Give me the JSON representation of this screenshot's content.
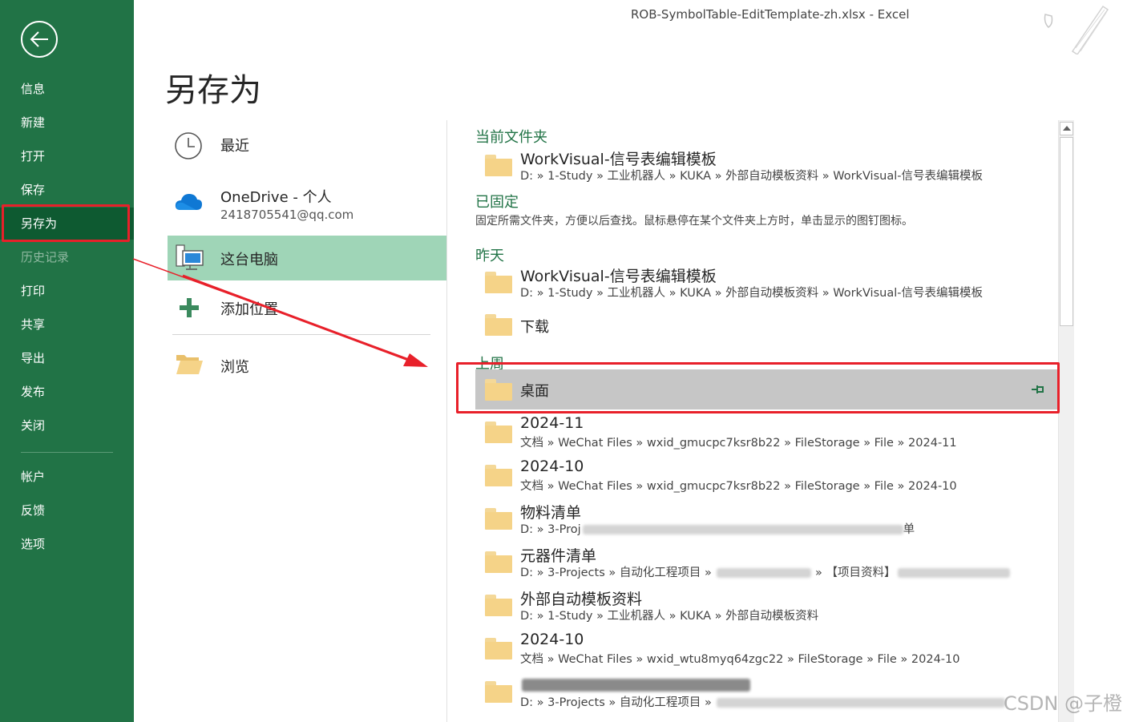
{
  "window": {
    "title": "ROB-SymbolTable-EditTemplate-zh.xlsx  -  Excel"
  },
  "nav": {
    "items": [
      {
        "label": "信息"
      },
      {
        "label": "新建"
      },
      {
        "label": "打开"
      },
      {
        "label": "保存"
      },
      {
        "label": "另存为"
      },
      {
        "label": "历史记录"
      },
      {
        "label": "打印"
      },
      {
        "label": "共享"
      },
      {
        "label": "导出"
      },
      {
        "label": "发布"
      },
      {
        "label": "关闭"
      },
      {
        "label": "帐户"
      },
      {
        "label": "反馈"
      },
      {
        "label": "选项"
      }
    ],
    "active_index": 4
  },
  "page_title": "另存为",
  "locations": {
    "recent": "最近",
    "onedrive": {
      "label": "OneDrive - 个人",
      "account": "2418705541@qq.com"
    },
    "this_pc": "这台电脑",
    "add_place": "添加位置",
    "browse": "浏览"
  },
  "sections": {
    "current": "当前文件夹",
    "pinned": "已固定",
    "pinned_hint": "固定所需文件夹，方便以后查找。鼠标悬停在某个文件夹上方时，单击显示的图钉图标。",
    "yesterday": "昨天",
    "last_week": "上周"
  },
  "entries": {
    "current_folder": {
      "title": "WorkVisual-信号表编辑模板",
      "path": "D: » 1-Study » 工业机器人 » KUKA » 外部自动模板资料 » WorkVisual-信号表编辑模板"
    },
    "yesterday_1": {
      "title": "WorkVisual-信号表编辑模板",
      "path": "D: » 1-Study » 工业机器人 » KUKA » 外部自动模板资料 » WorkVisual-信号表编辑模板"
    },
    "yesterday_2": {
      "title": "下载"
    },
    "desktop": {
      "title": "桌面"
    },
    "week_1": {
      "title": "2024-11",
      "path": "文档 » WeChat Files » wxid_gmucpc7ksr8b22 » FileStorage » File » 2024-11"
    },
    "week_2": {
      "title": "2024-10",
      "path": "文档 » WeChat Files » wxid_gmucpc7ksr8b22 » FileStorage » File » 2024-10"
    },
    "week_3": {
      "title": "物料清单",
      "path_start": "D: » 3-Proj",
      "path_end": "单"
    },
    "week_4": {
      "title": "元器件清单",
      "path_start": "D: » 3-Projects » 自动化工程项目 » ",
      "path_mid": " » 【项目资料】"
    },
    "week_5": {
      "title": "外部自动模板资料",
      "path": "D: » 1-Study » 工业机器人 » KUKA » 外部自动模板资料"
    },
    "week_6": {
      "title": "2024-10",
      "path": "文档 » WeChat Files » wxid_wtu8myq64zgc22 » FileStorage » File » 2024-10"
    },
    "week_7": {
      "path_start": "D: » 3-Projects » 自动化工程项目 » "
    }
  },
  "watermark": "CSDN @子橙",
  "colors": {
    "nav_bg": "#217346",
    "nav_active": "#0e5a31",
    "selected_location": "#9fd5b7",
    "section_heading": "#217346",
    "highlight_row": "#c6c6c6",
    "annotation": "#e8202a"
  }
}
